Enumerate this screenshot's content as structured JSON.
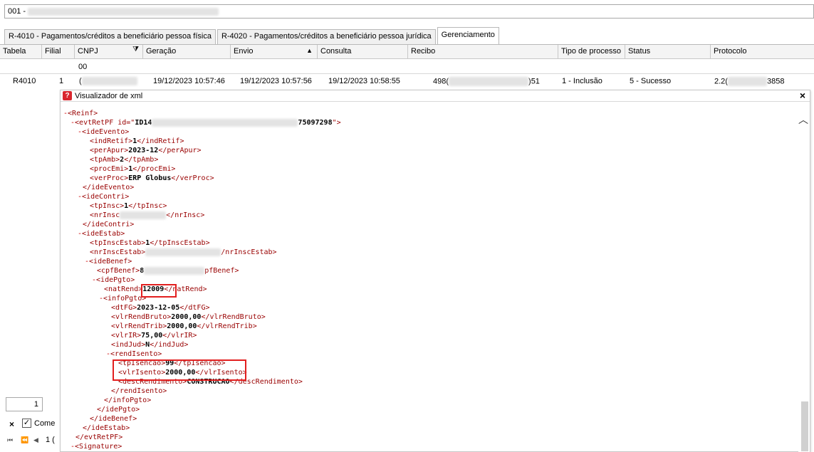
{
  "top_field": {
    "prefix": "001 -"
  },
  "tabs": [
    {
      "label": "R-4010 - Pagamentos/créditos a beneficiário pessoa física"
    },
    {
      "label": "R-4020 - Pagamentos/créditos a beneficiário pessoa jurídica"
    },
    {
      "label": "Gerenciamento"
    }
  ],
  "grid": {
    "columns": {
      "tabela": "Tabela",
      "filial": "Filial",
      "cnpj": "CNPJ",
      "geracao": "Geração",
      "envio": "Envio",
      "consulta": "Consulta",
      "recibo": "Recibo",
      "tipo": "Tipo de processo",
      "status": "Status",
      "protocolo": "Protocolo"
    },
    "filter_value": "00",
    "row": {
      "tabela": "R4010",
      "filial": "1",
      "cnpj_prefix": "(",
      "geracao": "19/12/2023 10:57:46",
      "envio": "19/12/2023 10:57:56",
      "consulta": "19/12/2023 10:58:55",
      "recibo_prefix": "498(",
      "recibo_suffix": ")51",
      "tipo": "1 - Inclusão",
      "status": "5 - Sucesso",
      "protocolo_prefix": "2.2(",
      "protocolo_suffix": "3858"
    }
  },
  "xml_viewer": {
    "title": "Visualizador de xml",
    "close": "×",
    "lines": {
      "reinf": "<Reinf>",
      "evt_start": "<evtRetPF id=\"",
      "evt_id_prefix": "ID14",
      "evt_id_suffix": "7509729",
      "evt_id_end": "8",
      "evt_end": "\">",
      "ideEvento": "<ideEvento>",
      "indRetif_open": "<indRetif>",
      "indRetif": "1",
      "indRetif_close": "</indRetif>",
      "perApur_open": "<perApur>",
      "perApur": "2023-12",
      "perApur_close": "</perApur>",
      "tpAmb_open": "<tpAmb>",
      "tpAmb": "2",
      "tpAmb_close": "</tpAmb>",
      "procEmi_open": "<procEmi>",
      "procEmi": "1",
      "procEmi_close": "</procEmi>",
      "verProc_open": "<verProc>",
      "verProc": "ERP Globus",
      "verProc_close": "</verProc>",
      "ideEvento_close": "</ideEvento>",
      "ideContri": "<ideContri>",
      "tpInsc_open": "<tpInsc>",
      "tpInsc": "1",
      "tpInsc_close": "</tpInsc>",
      "nrInsc_open": "<nrInsc",
      "nrInsc_close": "</nrInsc>",
      "ideContri_close": "</ideContri>",
      "ideEstab": "<ideEstab>",
      "tpInscEstab_open": "<tpInscEstab>",
      "tpInscEstab": "1",
      "tpInscEstab_close": "</tpInscEstab>",
      "nrInscEstab_open": "<nrInscEstab>",
      "nrInscEstab_close": "/nrInscEstab>",
      "ideBenef": "<ideBenef>",
      "cpfBenef_open": "<cpfBenef>",
      "cpfBenef_val": "8",
      "cpfBenef_close": "pfBenef>",
      "idePgto": "<idePgto>",
      "natRend_open": "<natRend",
      "natRend_gt": ">",
      "natRend": "12009",
      "natRend_close_lt": "<",
      "natRend_close": "/natRend>",
      "infoPgto": "<infoPgto>",
      "dtFG_open": "<dtFG>",
      "dtFG": "2023-12-05",
      "dtFG_close": "</dtFG>",
      "vlrRendBruto_open": "<vlrRendBruto>",
      "vlrRendBruto": "2000,00",
      "vlrRendBruto_close": "</vlrRendBruto>",
      "vlrRendTrib_open": "<vlrRendTrib>",
      "vlrRendTrib": "2000,00",
      "vlrRendTrib_close": "</vlrRendTrib>",
      "vlrIR_open": "<vlrIR>",
      "vlrIR": "75,00",
      "vlrIR_close": "</vlrIR>",
      "indJud_open": "<indJud>",
      "indJud": "N",
      "indJud_close": "</indJud>",
      "rendIsento": "<rendIsento>",
      "tpIsencao_open": "<tpIsencao>",
      "tpIsencao": "99",
      "tpIsencao_close": "</tpIsencao>",
      "vlrIsento_open": "<vlrIsento>",
      "vlrIsento": "2000,00",
      "vlrIsento_close": "</vlrIsento>",
      "descRendimento_open": "<descRendimento>",
      "descRendimento": "CONSTRUCAO",
      "descRendimento_close": "</descRendimento>",
      "rendIsento_close": "</rendIsento>",
      "infoPgto_close": "</infoPgto>",
      "idePgto_close": "</idePgto>",
      "ideBenef_close": "</ideBenef>",
      "ideEstab_close": "</ideEstab>",
      "evt_close": "</evtRetPF>",
      "signature": "<Signature>"
    },
    "toggle_minus": "-"
  },
  "bottom_controls": {
    "page_value": "1",
    "x_label": "×",
    "check_mark": "✓",
    "check_label": "Come",
    "nav_first": "⏮",
    "nav_prev2": "⏪",
    "nav_prev": "◀",
    "page_num": "1 (",
    "filter_glyph": "⧩",
    "sort_glyph": "▲",
    "scroll_up_glyph": "︿"
  },
  "colors": {
    "highlight": "#e21f1f",
    "xml_tag": "#990000",
    "toggle": "#cc0000",
    "app_icon": "#d9262e"
  }
}
